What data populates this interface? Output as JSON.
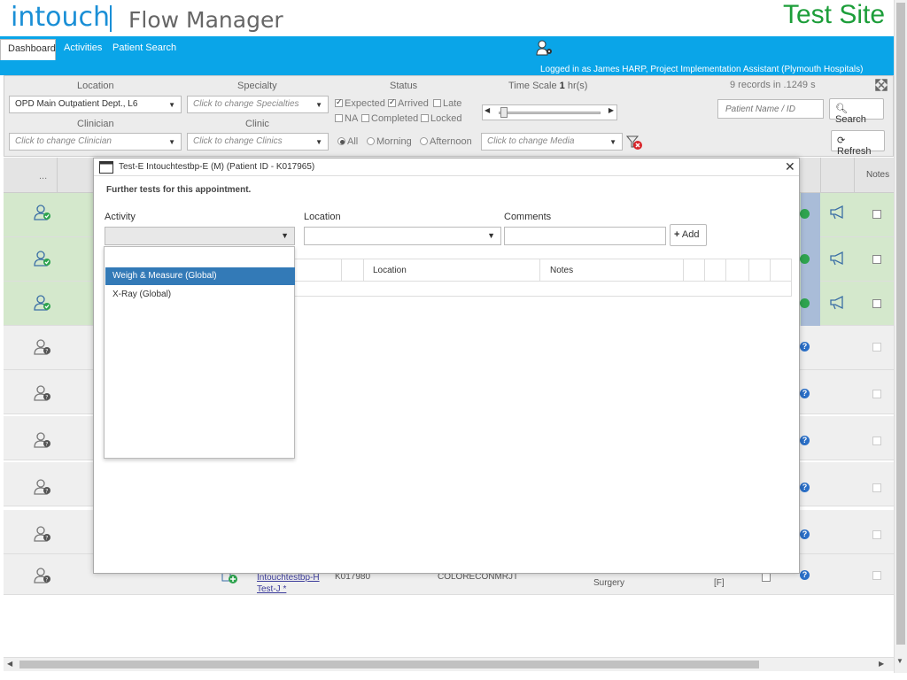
{
  "header": {
    "logo_brand": "intouch",
    "logo_product": "Flow Manager",
    "site_label": "Test Site",
    "logged_in": "Logged in as James HARP, Project Implementation Assistant (Plymouth Hospitals)"
  },
  "tabs": [
    {
      "label": "Dashboard",
      "active": true
    },
    {
      "label": "Activities",
      "active": false
    },
    {
      "label": "Patient Search",
      "active": false
    }
  ],
  "filters": {
    "location_label": "Location",
    "location_value": "OPD Main Outpatient Dept., L6",
    "specialty_label": "Specialty",
    "specialty_value": "Click to change Specialties",
    "status_label": "Status",
    "status_expected": "Expected",
    "status_arrived": "Arrived",
    "status_late": "Late",
    "status_na": "NA",
    "status_completed": "Completed",
    "status_locked": "Locked",
    "timescale_label": "Time Scale",
    "timescale_value": "1",
    "timescale_unit": "hr(s)",
    "records": "9 records in .1249 s",
    "clinician_label": "Clinician",
    "clinician_value": "Click to change Clinician",
    "clinic_label": "Clinic",
    "clinic_value": "Click to change Clinics",
    "time_all": "All",
    "time_morning": "Morning",
    "time_afternoon": "Afternoon",
    "media_value": "Click to change Media",
    "patient_placeholder": "Patient Name / ID",
    "search_label": "Search",
    "refresh_label": "Refresh"
  },
  "grid": {
    "col_dots": "...",
    "col_notes": "Notes",
    "last_row": {
      "name": "Intouchtestbp-H Test-J *",
      "id": "K017980",
      "clinic": "COLORECONMRJT",
      "specialty": "Surgery",
      "flag": "[F]"
    }
  },
  "modal": {
    "title": "Test-E Intouchtestbp-E (M) (Patient ID - K017965)",
    "subtitle": "Further tests for this appointment.",
    "activity_label": "Activity",
    "location_label": "Location",
    "comments_label": "Comments",
    "add_label": "Add",
    "table_col_location": "Location",
    "table_col_notes": "Notes",
    "activity_options": [
      "Weigh & Measure (Global)",
      "X-Ray (Global)"
    ]
  },
  "colors": {
    "brand_blue": "#1a8fd6",
    "site_green": "#1d9e3a",
    "bar_blue": "#0aa5e8",
    "row_green": "#d4e8cc",
    "selected_blue": "#337ab7"
  }
}
